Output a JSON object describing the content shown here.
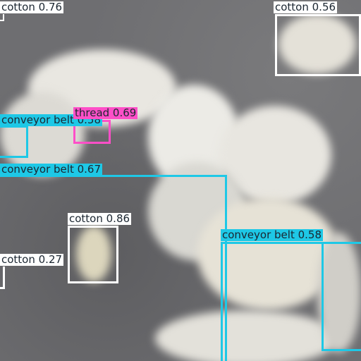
{
  "colors": {
    "cotton": "#ffffff",
    "conveyor_belt": "#1ec8e6",
    "thread": "#ff4fc8"
  },
  "detections": [
    {
      "id": "cotton-tl",
      "text": "cotton 0.76",
      "class": "cotton"
    },
    {
      "id": "cotton-tr",
      "text": "cotton 0.56",
      "class": "cotton"
    },
    {
      "id": "conveyor-1",
      "text": "conveyor belt 0.58",
      "class": "conveyor_belt"
    },
    {
      "id": "thread-1",
      "text": "thread 0.69",
      "class": "thread"
    },
    {
      "id": "conveyor-2",
      "text": "conveyor belt 0.67",
      "class": "conveyor_belt"
    },
    {
      "id": "cotton-mid",
      "text": "cotton 0.86",
      "class": "cotton"
    },
    {
      "id": "cotton-left",
      "text": "cotton 0.27",
      "class": "cotton"
    },
    {
      "id": "conveyor-3",
      "text": "conveyor belt 0.58",
      "class": "conveyor_belt"
    }
  ]
}
